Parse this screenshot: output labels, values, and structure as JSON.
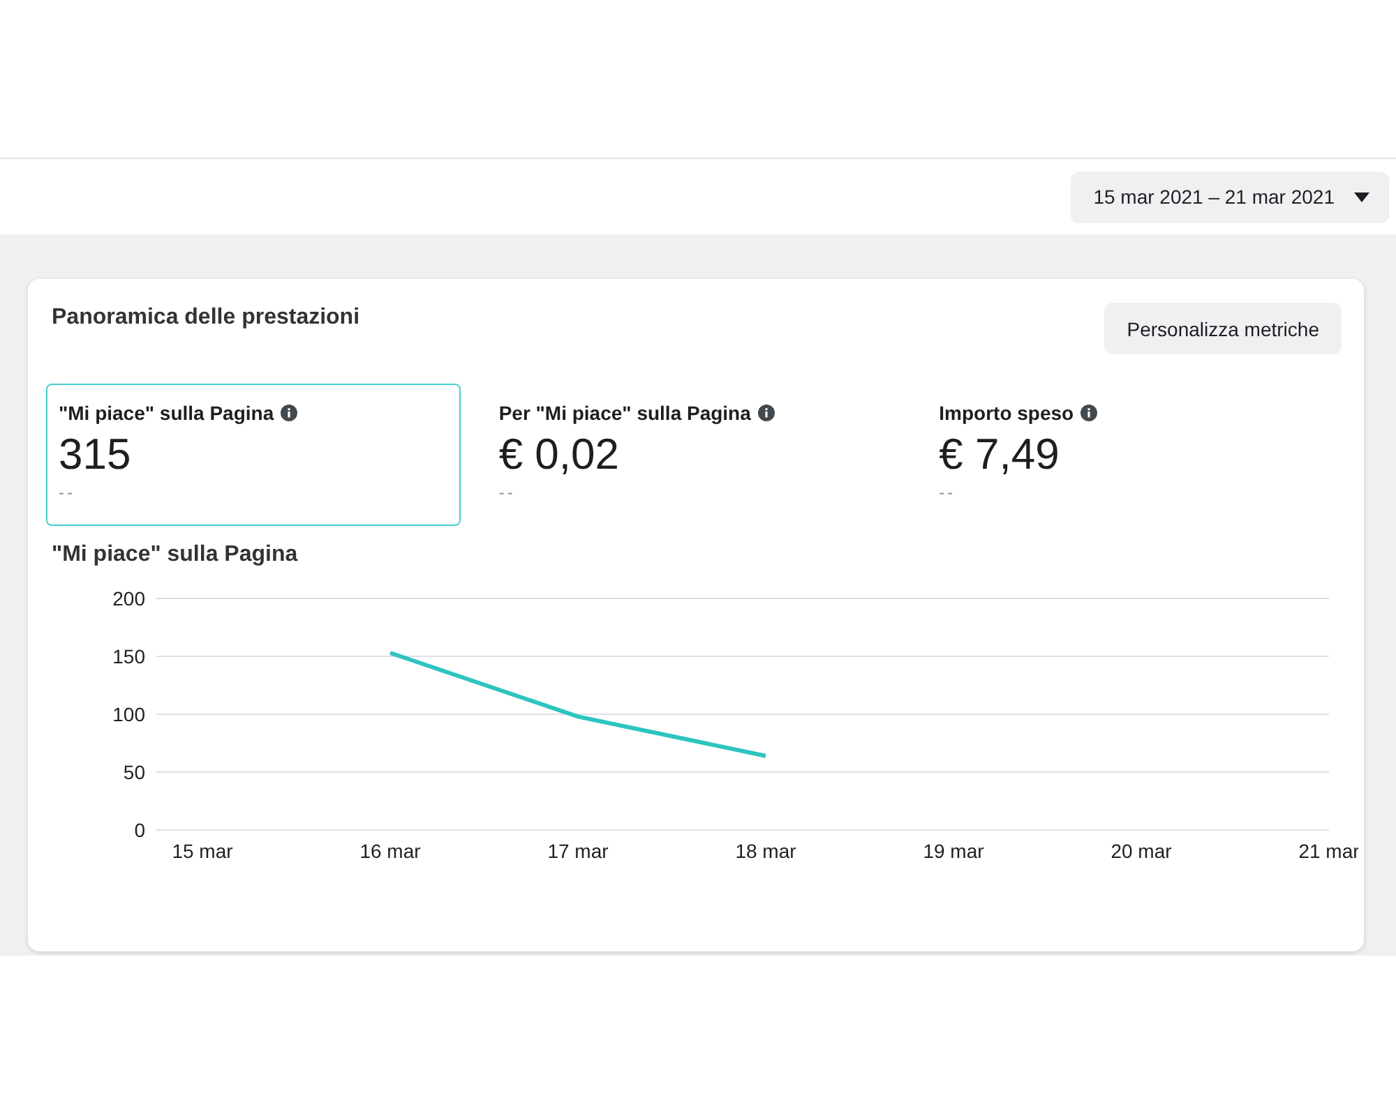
{
  "date_range": {
    "label": "15 mar 2021 – 21 mar 2021"
  },
  "card": {
    "title": "Panoramica delle prestazioni",
    "button": "Personalizza metriche",
    "metrics": [
      {
        "label": "\"Mi piace\" sulla Pagina",
        "value": "315",
        "delta": "--",
        "selected": true
      },
      {
        "label": "Per \"Mi piace\" sulla Pagina",
        "value": "€ 0,02",
        "delta": "--",
        "selected": false
      },
      {
        "label": "Importo speso",
        "value": "€ 7,49",
        "delta": "--",
        "selected": false
      }
    ],
    "chart_title": "\"Mi piace\" sulla Pagina",
    "chart_data": {
      "type": "line",
      "categories": [
        "15 mar",
        "16 mar",
        "17 mar",
        "18 mar",
        "19 mar",
        "20 mar",
        "21 mar"
      ],
      "grid": true,
      "series": [
        {
          "color": "#2ec4c0",
          "values": [
            null,
            153,
            98,
            64,
            null,
            null,
            null
          ]
        }
      ],
      "ylim": [
        0,
        200
      ],
      "yticks": [
        0,
        50,
        100,
        150,
        200
      ]
    }
  }
}
